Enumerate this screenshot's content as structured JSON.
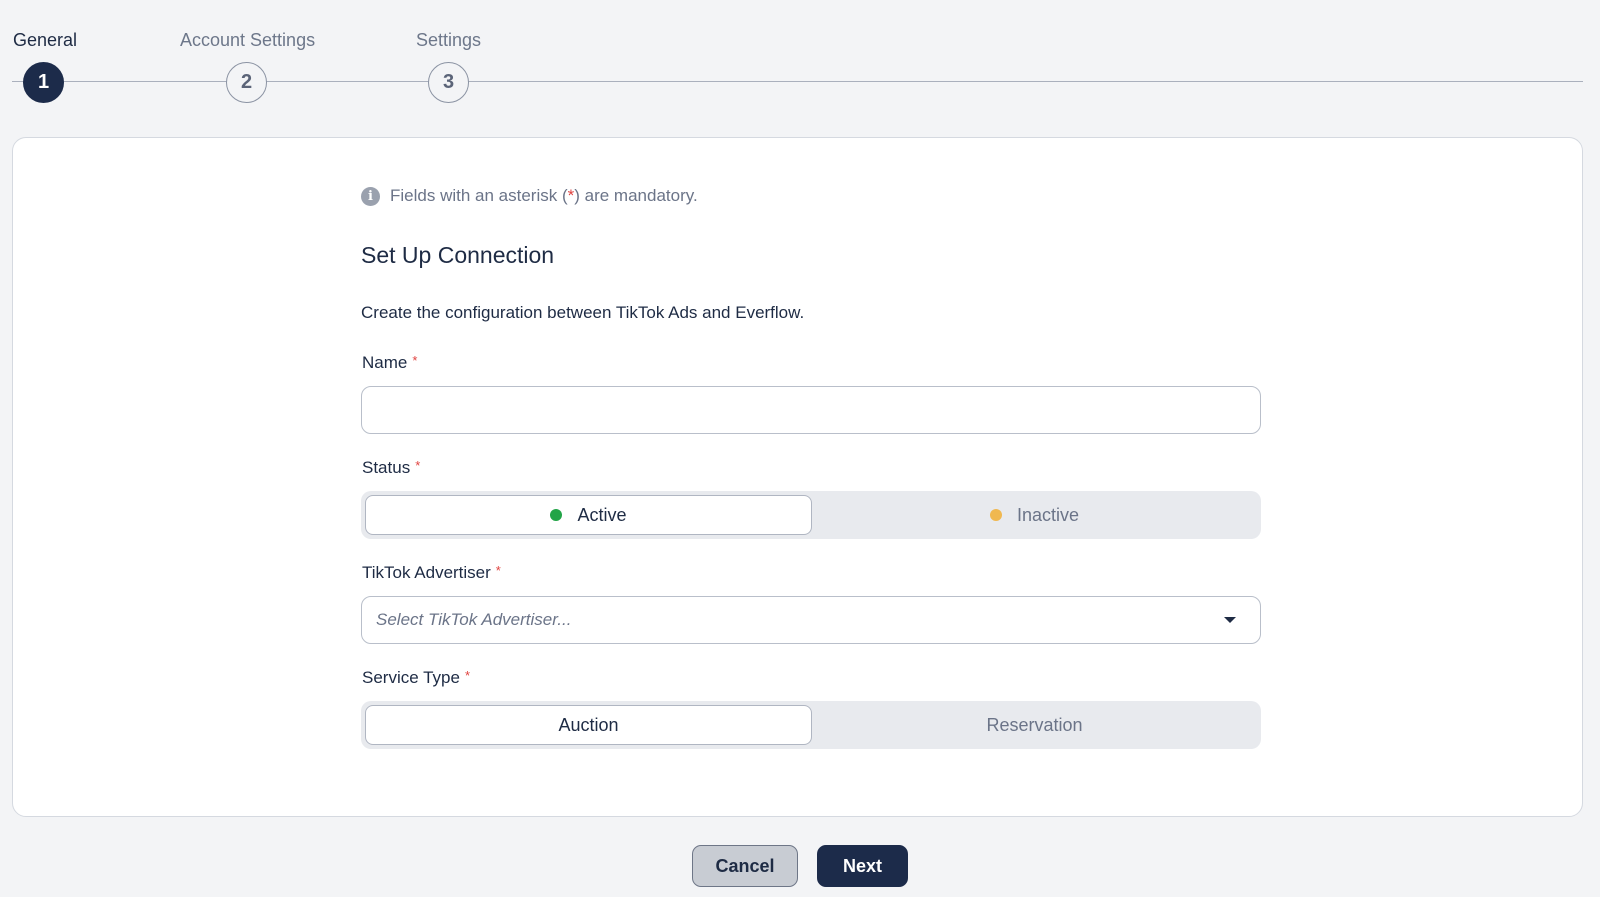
{
  "stepper": {
    "steps": [
      {
        "label": "General",
        "number": "1",
        "active": true
      },
      {
        "label": "Account Settings",
        "number": "2",
        "active": false
      },
      {
        "label": "Settings",
        "number": "3",
        "active": false
      }
    ]
  },
  "form": {
    "info_prefix": "Fields with an asterisk (",
    "info_asterisk": "*",
    "info_suffix": ") are mandatory.",
    "title": "Set Up Connection",
    "description": "Create the configuration between TikTok Ads and Everflow.",
    "name": {
      "label": "Name",
      "value": ""
    },
    "status": {
      "label": "Status",
      "options": [
        {
          "label": "Active",
          "color": "#22a447",
          "selected": true
        },
        {
          "label": "Inactive",
          "color": "#f0b850",
          "selected": false
        }
      ]
    },
    "advertiser": {
      "label": "TikTok Advertiser",
      "placeholder": "Select TikTok Advertiser..."
    },
    "service_type": {
      "label": "Service Type",
      "options": [
        {
          "label": "Auction",
          "selected": true
        },
        {
          "label": "Reservation",
          "selected": false
        }
      ]
    },
    "required_mark": "*"
  },
  "footer": {
    "cancel_label": "Cancel",
    "next_label": "Next"
  }
}
